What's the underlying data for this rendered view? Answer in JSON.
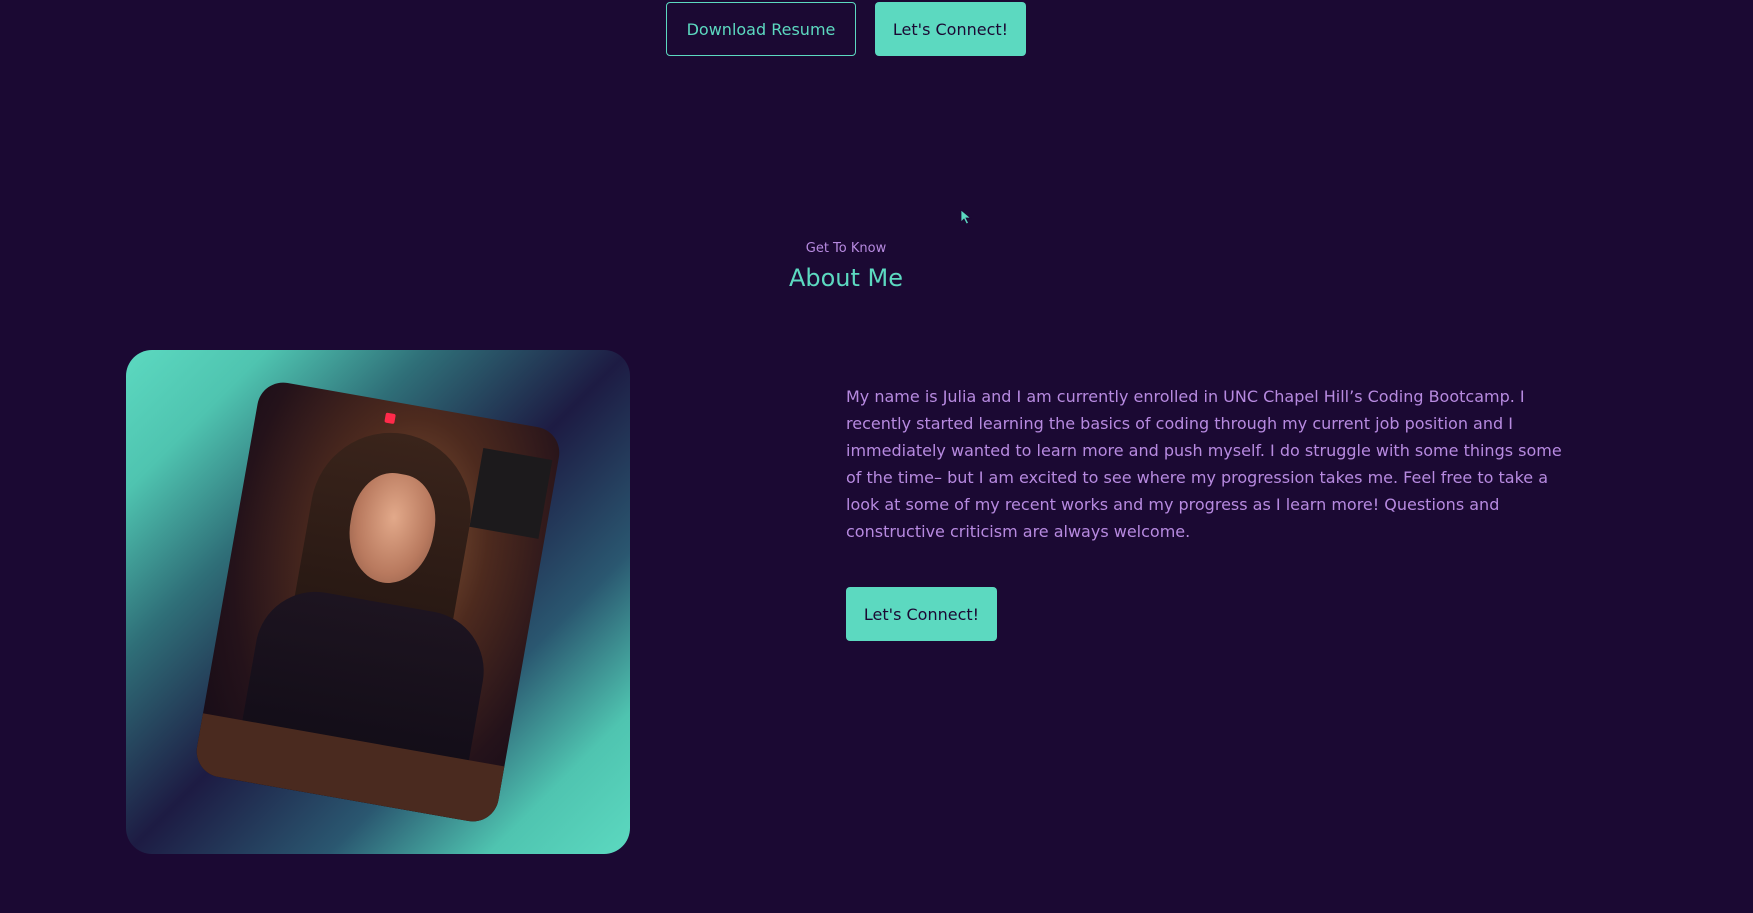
{
  "top_actions": {
    "download_label": "Download Resume",
    "connect_label": "Let's Connect!"
  },
  "about": {
    "subtitle": "Get To Know",
    "title": "About Me",
    "bio": "My name is Julia and I am currently enrolled in UNC Chapel Hill’s Coding Bootcamp. I recently started learning the basics of coding through my current job position and I immediately wanted to learn more and push myself. I do struggle with some things some of the time– but I am excited to see where my progression takes me. Feel free to take a look at some of my recent works and my progress as I learn more! Questions and constructive criticism are always welcome.",
    "connect_label": "Let's Connect!"
  },
  "theme": {
    "background": "#1b0933",
    "accent": "#5cd9c0",
    "text": "#b78ae0"
  }
}
